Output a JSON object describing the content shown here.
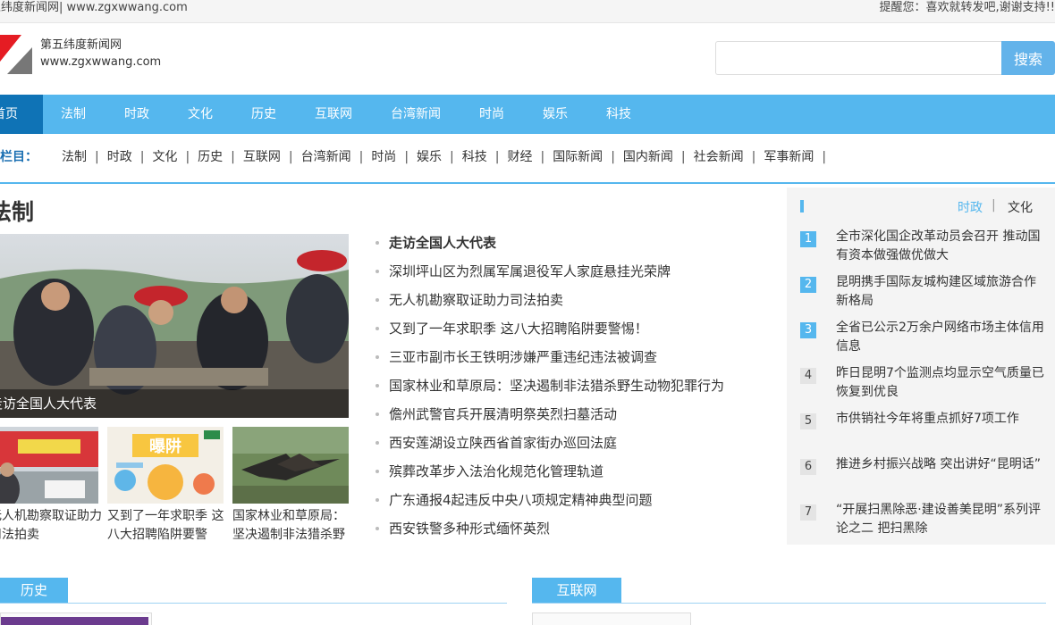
{
  "topbar": {
    "left_text": "五纬度新闻网| www.zgxwwang.com",
    "right_text": "提醒您：喜欢就转发吧,谢谢支持!!"
  },
  "header": {
    "site_name": "第五纬度新闻网",
    "site_url": "www.zgxwwang.com",
    "search_placeholder": "",
    "search_button": "搜索"
  },
  "nav": {
    "items": [
      "首页",
      "法制",
      "时政",
      "文化",
      "历史",
      "互联网",
      "台湾新闻",
      "时尚",
      "娱乐",
      "科技"
    ]
  },
  "subnav": {
    "label": "部栏目：",
    "items": [
      "法制",
      "时政",
      "文化",
      "历史",
      "互联网",
      "台湾新闻",
      "时尚",
      "娱乐",
      "科技",
      "财经",
      "国际新闻",
      "国内新闻",
      "社会新闻",
      "军事新闻"
    ],
    "separator": "|"
  },
  "section": {
    "title": "法制",
    "featured_caption": "走访全国人大代表",
    "thumbs": [
      {
        "caption": "无人机勘察取证助力司法拍卖",
        "icon": "photo"
      },
      {
        "caption": "又到了一年求职季 这八大招聘陷阱要警",
        "icon": "illustration",
        "badge": "曝阱"
      },
      {
        "caption": "国家林业和草原局：坚决遏制非法猎杀野",
        "icon": "photo"
      }
    ],
    "news": [
      "走访全国人大代表",
      "深圳坪山区为烈属军属退役军人家庭悬挂光荣牌",
      "无人机勘察取证助力司法拍卖",
      "又到了一年求职季 这八大招聘陷阱要警惕！",
      "三亚市副市长王铁明涉嫌严重违纪违法被调查",
      "国家林业和草原局：坚决遏制非法猎杀野生动物犯罪行为",
      "儋州武警官兵开展清明祭英烈扫墓活动",
      "西安莲湖设立陕西省首家街办巡回法庭",
      "殡葬改革步入法治化规范化管理轨道",
      "广东通报4起违反中央八项规定精神典型问题",
      "西安铁警多种形式缅怀英烈"
    ]
  },
  "sidebar": {
    "tabs": [
      "时政",
      "文化"
    ],
    "tab_separator": "|",
    "items": [
      {
        "num": "1",
        "text": "全市深化国企改革动员会召开 推动国有资本做强做优做大"
      },
      {
        "num": "2",
        "text": "昆明携手国际友城构建区域旅游合作新格局"
      },
      {
        "num": "3",
        "text": "全省已公示2万余户网络市场主体信用信息"
      },
      {
        "num": "4",
        "text": "昨日昆明7个监测点均显示空气质量已恢复到优良"
      },
      {
        "num": "5",
        "text": "市供销社今年将重点抓好7项工作"
      },
      {
        "num": "6",
        "text": "推进乡村振兴战略 突出讲好“昆明话”"
      },
      {
        "num": "7",
        "text": "“开展扫黑除恶·建设善美昆明”系列评论之二 把扫黑除"
      }
    ],
    "highlight_color": "#55b7ee"
  },
  "bottom": {
    "tabs": [
      "历史",
      "互联网"
    ]
  },
  "colors": {
    "nav": "#55b7ee",
    "nav_active": "#0f73b6",
    "accent": "#55b7ee"
  }
}
